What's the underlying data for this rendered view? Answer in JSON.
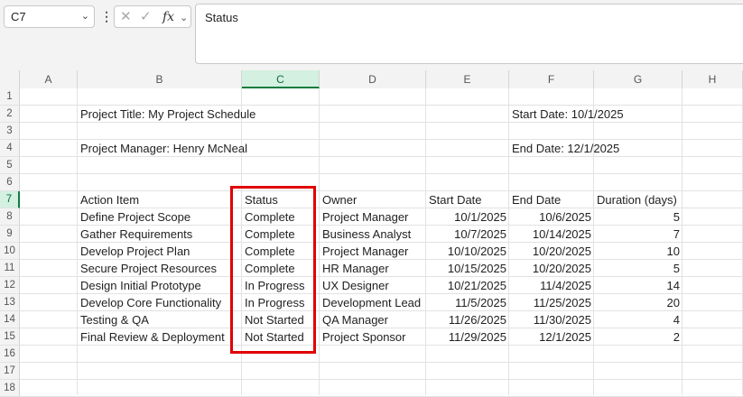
{
  "name_box": "C7",
  "formula_bar": "Status",
  "formula_icons": [
    "cancel-icon",
    "enter-icon",
    "function-icon"
  ],
  "columns": [
    "A",
    "B",
    "C",
    "D",
    "E",
    "F",
    "G",
    "H"
  ],
  "selected_column": "C",
  "rows": [
    "1",
    "2",
    "3",
    "4",
    "5",
    "6",
    "7",
    "8",
    "9",
    "10",
    "11",
    "12",
    "13",
    "14",
    "15",
    "16",
    "17",
    "18"
  ],
  "selected_row": "7",
  "project": {
    "title": "Project Title: My Project Schedule",
    "start": "Start Date: 10/1/2025",
    "manager": "Project Manager: Henry McNeal",
    "end": "End Date: 12/1/2025"
  },
  "table": {
    "headers": [
      "Action Item",
      "Status",
      "Owner",
      "Start Date",
      "End Date",
      "Duration (days)"
    ],
    "rows": [
      [
        "Define Project Scope",
        "Complete",
        "Project Manager",
        "10/1/2025",
        "10/6/2025",
        "5"
      ],
      [
        "Gather Requirements",
        "Complete",
        "Business Analyst",
        "10/7/2025",
        "10/14/2025",
        "7"
      ],
      [
        "Develop Project Plan",
        "Complete",
        "Project Manager",
        "10/10/2025",
        "10/20/2025",
        "10"
      ],
      [
        "Secure Project Resources",
        "Complete",
        "HR Manager",
        "10/15/2025",
        "10/20/2025",
        "5"
      ],
      [
        "Design Initial Prototype",
        "In Progress",
        "UX Designer",
        "10/21/2025",
        "11/4/2025",
        "14"
      ],
      [
        "Develop Core Functionality",
        "In Progress",
        "Development Lead",
        "11/5/2025",
        "11/25/2025",
        "20"
      ],
      [
        "Testing & QA",
        "Not Started",
        "QA Manager",
        "11/26/2025",
        "11/30/2025",
        "4"
      ],
      [
        "Final Review & Deployment",
        "Not Started",
        "Project Sponsor",
        "11/29/2025",
        "12/1/2025",
        "2"
      ]
    ]
  },
  "colors": {
    "accent": "#107c41",
    "highlight": "#e00000"
  }
}
